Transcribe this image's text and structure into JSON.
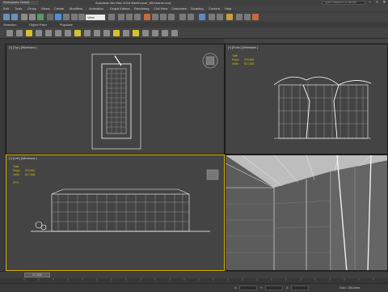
{
  "app": {
    "workspace": "Workspaces: Default",
    "title": "Autodesk 3ds Max 2018    Warehouse_Wireframe.max",
    "search_placeholder": "Type a keyword or phrase"
  },
  "menu": [
    "Edit",
    "Tools",
    "Group",
    "Views",
    "Create",
    "Modifiers",
    "Animation",
    "Graph Editors",
    "Rendering",
    "Civil View",
    "Customize",
    "Scripting",
    "Content",
    "Help"
  ],
  "toolbar": {
    "view_select": "View"
  },
  "ribbon_tabs": [
    "Selection",
    "Object Paint",
    "Populate"
  ],
  "viewports": {
    "top": {
      "label": "[+] [Top ] [Wireframe ]"
    },
    "front": {
      "label": "[+] [Front ] [Wireframe ]"
    },
    "left": {
      "label": "[+] [Left ] [Wireframe ]"
    },
    "persp": {
      "label": ""
    }
  },
  "stats": {
    "total": "Total",
    "polys_label": "Polys:",
    "polys": "978,962",
    "verts_label": "Verts:",
    "verts": "617,836",
    "fps_label": "FPS:"
  },
  "timeline": {
    "slider": "0 / 100"
  },
  "statusbar": {
    "x_label": "X:",
    "y_label": "Y:",
    "z_label": "Z:",
    "grid": "Grid = 254,0mm",
    "addtime": "Add Time Tag"
  },
  "colors": {
    "viewport_bg": "#444444",
    "wire": "#ffffff",
    "stats": "#d6c000",
    "active_border": "#d8b800"
  }
}
